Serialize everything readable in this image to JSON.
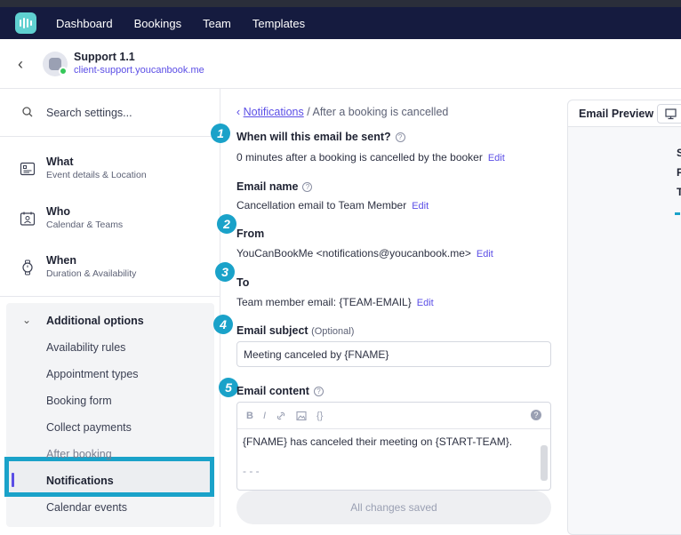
{
  "nav": {
    "items": [
      "Dashboard",
      "Bookings",
      "Team",
      "Templates"
    ]
  },
  "header": {
    "title": "Support 1.1",
    "url": "client-support.youcanbook.me"
  },
  "sidebar": {
    "search_placeholder": "Search settings...",
    "sections": [
      {
        "title": "What",
        "subtitle": "Event details & Location",
        "icon": "card-icon"
      },
      {
        "title": "Who",
        "subtitle": "Calendar & Teams",
        "icon": "person-calendar-icon"
      },
      {
        "title": "When",
        "subtitle": "Duration & Availability",
        "icon": "watch-icon"
      }
    ],
    "additional_options": "Additional options",
    "items": [
      "Availability rules",
      "Appointment types",
      "Booking form",
      "Collect payments",
      "After booking",
      "Notifications",
      "Calendar events"
    ],
    "active_item": "Notifications"
  },
  "main": {
    "breadcrumb_link": "Notifications",
    "breadcrumb_current": "After a booking is cancelled",
    "fields": {
      "when_label": "When will this email be sent?",
      "when_value": "0 minutes after a booking is cancelled by the booker",
      "name_label": "Email name",
      "name_value": "Cancellation email to Team Member",
      "from_label": "From",
      "from_value": "YouCanBookMe <notifications@youcanbook.me>",
      "to_label": "To",
      "to_value": "Team member email: {TEAM-EMAIL}",
      "subject_label": "Email subject",
      "subject_optional": "(Optional)",
      "subject_value": "Meeting canceled by {FNAME}",
      "content_label": "Email content",
      "content_text": "{FNAME} has canceled their meeting on {START-TEAM}.",
      "content_separator": "- - -"
    },
    "edit_label": "Edit",
    "step_numbers": [
      "1",
      "2",
      "3",
      "4",
      "5"
    ],
    "save_status": "All changes saved",
    "toolbar": [
      "B",
      "I",
      "link",
      "image",
      "{}"
    ]
  },
  "preview": {
    "title": "Email Preview",
    "letters": [
      "S",
      "F",
      "T"
    ]
  },
  "colors": {
    "nav_bg": "#151b3f",
    "accent": "#5b4ee6",
    "annotation": "#1aa2c9"
  }
}
